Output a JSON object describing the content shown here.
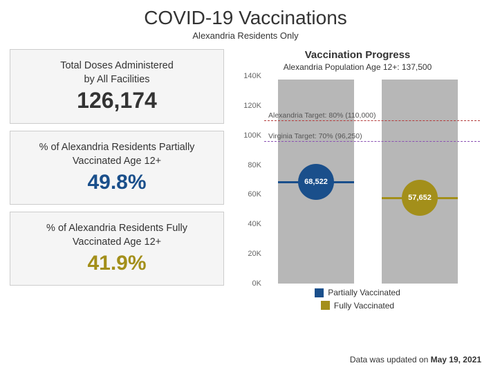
{
  "header": {
    "title": "COVID-19 Vaccinations",
    "subtitle": "Alexandria Residents Only"
  },
  "cards": {
    "total_doses": {
      "label1": "Total Doses Administered",
      "label2": "by All Facilities",
      "value": "126,174"
    },
    "partial_pct": {
      "label1": "% of Alexandria Residents Partially",
      "label2": "Vaccinated Age 12+",
      "value": "49.8%"
    },
    "full_pct": {
      "label1": "% of Alexandria Residents Fully",
      "label2": "Vaccinated Age 12+",
      "value": "41.9%"
    }
  },
  "chart": {
    "title": "Vaccination Progress",
    "subtitle": "Alexandria Population Age 12+: 137,500",
    "legend": {
      "partial": "Partially Vaccinated",
      "full": "Fully Vaccinated"
    },
    "targets": {
      "alexandria_label": "Alexandria Target: 80% (110,000)",
      "virginia_label": "Virginia Target: 70% (96,250)"
    },
    "values": {
      "partial_label": "68,522",
      "full_label": "57,652"
    }
  },
  "footer": {
    "prefix": "Data was updated on ",
    "date": "May 19, 2021"
  },
  "colors": {
    "partial": "#1a4f8b",
    "full": "#a38f1a",
    "alexandria_target": "#b33a3a",
    "virginia_target": "#8a4fb3"
  },
  "chart_data": {
    "type": "bar",
    "title": "Vaccination Progress",
    "subtitle": "Alexandria Population Age 12+: 137,500",
    "ylabel": "",
    "ylim": [
      0,
      140000
    ],
    "yticks": [
      0,
      20000,
      40000,
      60000,
      80000,
      100000,
      120000,
      140000
    ],
    "ytick_labels": [
      "0K",
      "20K",
      "40K",
      "60K",
      "80K",
      "100K",
      "120K",
      "140K"
    ],
    "categories": [
      "Partially Vaccinated",
      "Fully Vaccinated"
    ],
    "series": [
      {
        "name": "Population Age 12+",
        "values": [
          137500,
          137500
        ],
        "role": "background"
      },
      {
        "name": "Vaccinated",
        "values": [
          68522,
          57652
        ],
        "role": "marker"
      }
    ],
    "reference_lines": [
      {
        "name": "Alexandria Target",
        "value": 110000,
        "label": "Alexandria Target: 80% (110,000)"
      },
      {
        "name": "Virginia Target",
        "value": 96250,
        "label": "Virginia Target: 70% (96,250)"
      }
    ],
    "colors": {
      "Partially Vaccinated": "#1a4f8b",
      "Fully Vaccinated": "#a38f1a"
    }
  }
}
